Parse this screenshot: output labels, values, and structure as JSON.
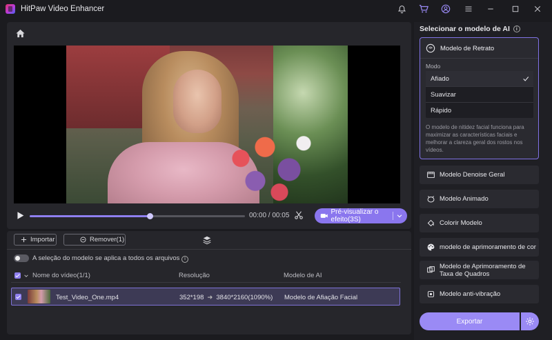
{
  "app": {
    "title": "HitPaw Video Enhancer"
  },
  "player": {
    "time": "00:00 / 00:05",
    "progress": 0.56,
    "preview_label": "Pré-visualizar o efeito(3S)"
  },
  "file_panel": {
    "import_label": "Importar",
    "remove_label": "Remover(1)",
    "apply_all_label": "A seleção do modelo se aplica a todos os arquivos",
    "columns": {
      "name": "Nome do vídeo(1/1)",
      "resolution": "Resolução",
      "model": "Modelo de AI"
    },
    "rows": [
      {
        "name": "Test_Video_One.mp4",
        "res_from": "352*198",
        "res_to": "3840*2160(1090%)",
        "model": "Modelo de Afiação Facial"
      }
    ]
  },
  "model_panel": {
    "title": "Selecionar o modelo de AI",
    "selected_model": {
      "name": "Modelo de Retrato",
      "mode_label": "Modo",
      "options": [
        "Afiado",
        "Suavizar",
        "Rápido"
      ],
      "selected_option": "Afiado",
      "description": "O modelo de nitidez facial funciona para maximizar as características faciais e melhorar a clareza geral dos rostos nos vídeos."
    },
    "models": [
      {
        "label": "Modelo Denoise Geral",
        "icon": "film-icon"
      },
      {
        "label": "Modelo Animado",
        "icon": "animal-face-icon"
      },
      {
        "label": "Colorir Modelo",
        "icon": "paint-bucket-icon"
      },
      {
        "label": "modelo de aprimoramento de cor",
        "icon": "palette-icon"
      },
      {
        "label": "Modelo de Aprimoramento de Taxa de Quadros",
        "icon": "frames-icon"
      },
      {
        "label": "Modelo anti-vibração",
        "icon": "stabilize-icon"
      }
    ],
    "export_label": "Exportar"
  },
  "colors": {
    "accent": "#8a76ee",
    "panel": "#26262b",
    "background": "#1b1b1f"
  }
}
